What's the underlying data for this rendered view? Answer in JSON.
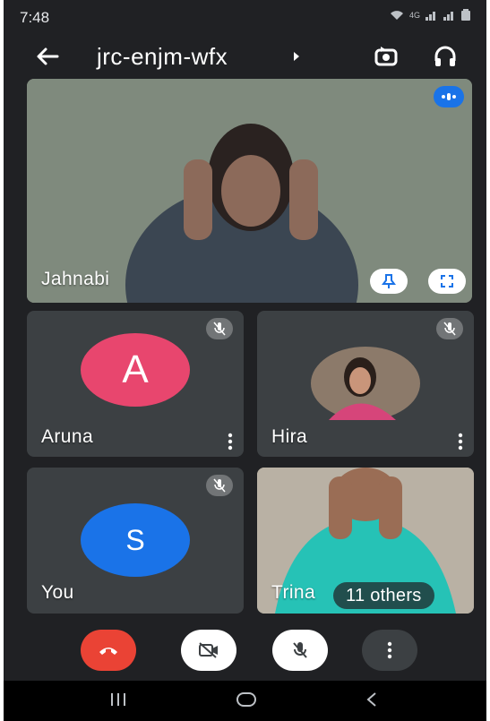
{
  "status_bar": {
    "time": "7:48",
    "network_label": "4G"
  },
  "app_bar": {
    "meeting_code": "jrc-enjm-wfx"
  },
  "participants": {
    "main": {
      "name": "Jahnabi"
    },
    "aruna": {
      "name": "Aruna",
      "avatar_letter": "A",
      "avatar_color": "#e8466e"
    },
    "hira": {
      "name": "Hira"
    },
    "you": {
      "name": "You",
      "avatar_letter": "S",
      "avatar_color": "#1a73e8"
    },
    "trina": {
      "name": "Trina"
    }
  },
  "others": {
    "label": "11 others"
  },
  "controls": {
    "end_call_color": "#ea4335",
    "icons": [
      "end-call-icon",
      "camera-off-icon",
      "mic-off-icon",
      "more-vert-icon"
    ]
  },
  "colors": {
    "background": "#202124",
    "tile": "#3c4043",
    "accent": "#1a73e8"
  }
}
